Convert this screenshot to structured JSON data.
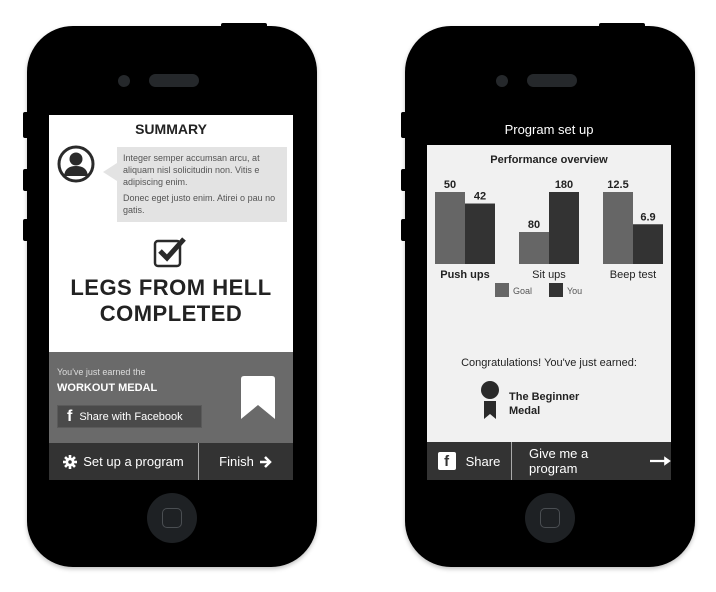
{
  "summary_screen": {
    "title": "SUMMARY",
    "message_paragraphs": [
      "Integer semper accumsan arcu, at aliquam nisl solicitudin non. Vitis e adipiscing enim.",
      "Donec eget justo enim. Atirei o pau no gatis."
    ],
    "completion_line1": "LEGS FROM HELL",
    "completion_line2": "COMPLETED",
    "earned_label": "You've just earned the",
    "medal_name": "WORKOUT MEDAL",
    "share_facebook_label": "Share with Facebook",
    "facebook_glyph": "f",
    "setup_program_label": "Set up a program",
    "finish_label": "Finish"
  },
  "program_screen": {
    "header_title": "Program set up",
    "congrats_text": "Congratulations! You've just earned:",
    "medal_name_line1": "The Beginner",
    "medal_name_line2": "Medal",
    "share_label": "Share",
    "facebook_glyph": "f",
    "give_program_label": "Give me a program"
  },
  "chart_data": {
    "type": "bar",
    "title": "Performance overview",
    "categories": [
      "Push ups",
      "Sit ups",
      "Beep test"
    ],
    "series": [
      {
        "name": "Goal",
        "values": [
          50,
          80,
          12.5
        ],
        "color": "#666666"
      },
      {
        "name": "You",
        "values": [
          42,
          180,
          6.9
        ],
        "color": "#333333"
      }
    ],
    "value_labels": [
      [
        "50",
        "42"
      ],
      [
        "80",
        "180"
      ],
      [
        "12.5",
        "6.9"
      ]
    ],
    "bold_category": "Push ups",
    "normalization": "per-category (tallest bar in each group = 100%)",
    "xlabel": "",
    "ylabel": "",
    "grid": false,
    "legend_position": "bottom-center"
  }
}
